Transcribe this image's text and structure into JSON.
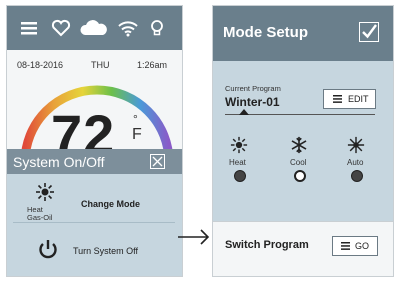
{
  "colors": {
    "header": "#6a7f8c",
    "panel": "#c6d6df",
    "overlay_header": "#7d8f9b"
  },
  "left_screen": {
    "top_icons": [
      "menu-icon",
      "heart-icon",
      "cloud-icon",
      "wifi-icon",
      "lightbulb-icon"
    ],
    "date": "08-18-2016",
    "day": "THU",
    "time": "1:26am",
    "temperature": "72",
    "degree_symbol": "°",
    "unit": "F",
    "overlay": {
      "title": "System On/Off",
      "mode_label_1": "Heat",
      "mode_label_2": "Gas-Oil",
      "change_mode": "Change Mode",
      "turn_off": "Turn System Off"
    }
  },
  "right_screen": {
    "title": "Mode Setup",
    "current_program_label": "Current Program",
    "program_name": "Winter-01",
    "edit_label": "EDIT",
    "modes": [
      {
        "label": "Heat",
        "icon": "sun-icon",
        "selected": false
      },
      {
        "label": "Cool",
        "icon": "snowflake-icon",
        "selected": true
      },
      {
        "label": "Auto",
        "icon": "auto-icon",
        "selected": false
      }
    ],
    "switch_program_label": "Switch Program",
    "go_label": "GO"
  }
}
